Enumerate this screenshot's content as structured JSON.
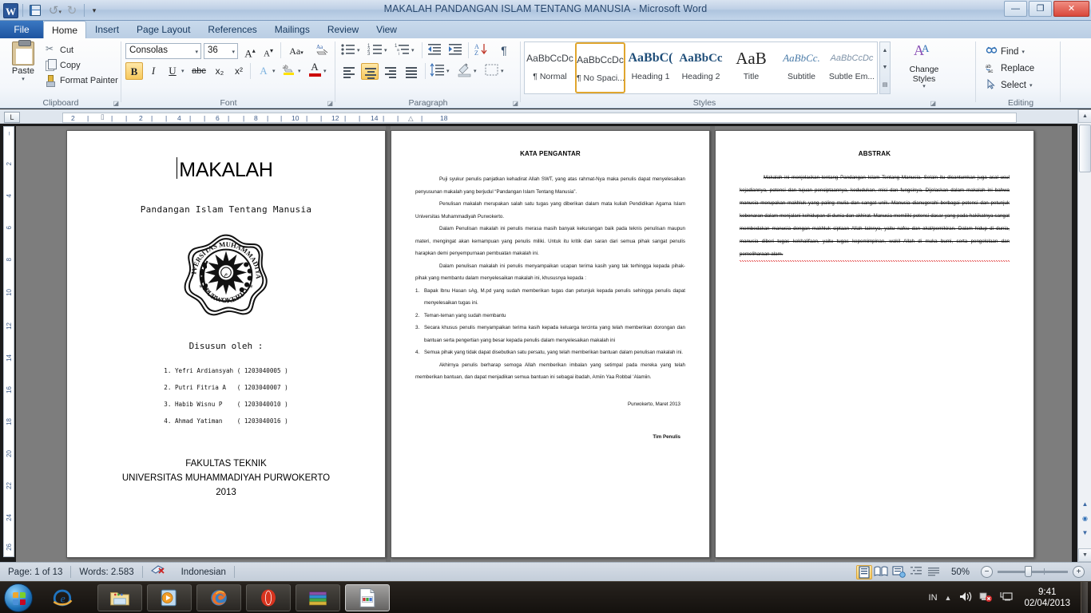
{
  "window": {
    "title": "MAKALAH PANDANGAN ISLAM TENTANG MANUSIA  -  Microsoft Word",
    "app_icon": "W",
    "minimize": "—",
    "maximize": "❐",
    "close": "✕"
  },
  "quick_access": {
    "save": "save-icon",
    "undo": "↺",
    "redo": "↻",
    "customize": "▾"
  },
  "tabs": [
    {
      "label": "File",
      "active": false,
      "file": true
    },
    {
      "label": "Home",
      "active": true
    },
    {
      "label": "Insert",
      "active": false
    },
    {
      "label": "Page Layout",
      "active": false
    },
    {
      "label": "References",
      "active": false
    },
    {
      "label": "Mailings",
      "active": false
    },
    {
      "label": "Review",
      "active": false
    },
    {
      "label": "View",
      "active": false
    }
  ],
  "ribbon": {
    "clipboard": {
      "group_label": "Clipboard",
      "paste_label": "Paste",
      "cut_label": "Cut",
      "copy_label": "Copy",
      "format_painter_label": "Format Painter"
    },
    "font": {
      "group_label": "Font",
      "font_name": "Consolas",
      "font_size": "36",
      "grow_font": "A",
      "shrink_font": "A",
      "change_case": "Aa",
      "clear_formatting": "clear-formatting-icon",
      "bold": "B",
      "italic": "I",
      "underline": "U",
      "strikethrough": "abc",
      "subscript": "x₂",
      "superscript": "x²",
      "text_effects": "A",
      "highlight": "ab",
      "font_color": "A"
    },
    "paragraph": {
      "group_label": "Paragraph",
      "bullets": "bullets-icon",
      "numbering": "numbering-icon",
      "multilevel": "multilevel-list-icon",
      "decrease_indent": "decrease-indent-icon",
      "increase_indent": "increase-indent-icon",
      "sort": "sort-icon",
      "show_marks": "¶",
      "align_left": "align-left-icon",
      "align_center": "align-center-icon",
      "align_right": "align-right-icon",
      "justify": "justify-icon",
      "line_spacing": "line-spacing-icon",
      "shading": "shading-icon",
      "borders": "borders-icon"
    },
    "styles": {
      "group_label": "Styles",
      "items": [
        {
          "sample": "AaBbCcDc",
          "name": "¶ Normal",
          "selected": false
        },
        {
          "sample": "AaBbCcDc",
          "name": "¶ No Spaci...",
          "selected": true
        },
        {
          "sample": "AaBbC(",
          "name": "Heading 1",
          "selected": false
        },
        {
          "sample": "AaBbCc",
          "name": "Heading 2",
          "selected": false
        },
        {
          "sample": "AaB",
          "name": "Title",
          "selected": false
        },
        {
          "sample": "AaBbCc.",
          "name": "Subtitle",
          "selected": false
        },
        {
          "sample": "AaBbCcDc",
          "name": "Subtle Em...",
          "selected": false
        }
      ],
      "change_styles_line1": "Change",
      "change_styles_line2": "Styles"
    },
    "editing": {
      "group_label": "Editing",
      "find": "Find",
      "replace": "Replace",
      "select": "Select"
    }
  },
  "ruler": {
    "horizontal_ticks": [
      "2",
      "2",
      "4",
      "6",
      "8",
      "10",
      "12",
      "14",
      "18"
    ],
    "vertical_ticks": [
      "2",
      "4",
      "6",
      "8",
      "10",
      "12",
      "14",
      "16",
      "18",
      "20",
      "22",
      "24",
      "26"
    ],
    "corner_tab_stop": "L"
  },
  "document": {
    "page1": {
      "title": "MAKALAH",
      "subtitle": "Pandangan Islam Tentang Manusia",
      "logo_alt": "universitas-muhammadiyah-purwokerto-logo",
      "authors_heading": "Disusun oleh :",
      "authors": [
        "1. Yefri Ardiansyah ( 1203040005 )",
        "2. Putri Fitria A   ( 1203040007 )",
        "3. Habib Wisnu P    ( 1203040010 )",
        "4. Ahmad Yatiman    ( 1203040016 )"
      ],
      "footer": [
        "FAKULTAS TEKNIK",
        "UNIVERSITAS MUHAMMADIYAH PURWOKERTO",
        "2013"
      ]
    },
    "page2": {
      "heading": "KATA PENGANTAR",
      "paragraphs": [
        "Puji syukur penulis panjatkan kehadirat Allah SWT, yang atas rahmat-Nya maka penulis dapat menyelesaikan penyusunan makalah yang berjudul “Pandangan Islam Tentang Manusia”.",
        "Penulisan makalah merupakan salah satu tugas yang diberikan dalam mata kuliah Pendidikan Agama Islam Universitas Muhammadiyah Purwokerto.",
        "Dalam Penulisan makalah ini penulis merasa masih banyak kekurangan baik pada teknis penulisan maupun materi, mengingat akan kemampuan yang penulis miliki. Untuk itu kritik dan saran dari semua pihak sangat penulis harapkan demi penyempurnaan pembuatan makalah ini.",
        "Dalam penulisan makalah ini penulis menyampaikan ucapan terima kasih yang tak terhingga kepada pihak-pihak yang membantu dalam menyelesaikan makalah ini, khususnya kepada :"
      ],
      "list": [
        "Bapak Ibnu Hasan sAg, M.pd yang sudah memberikan tugas dan petunjuk kepada penulis sehingga penulis dapat menyelesaikan tugas ini.",
        "Teman-teman yang sudah membantu",
        "Secara khusus penulis menyampaikan terima kasih kepada keluarga tercinta yang telah memberikan dorongan dan bantuan serta pengertian yang besar kepada penulis dalam menyelesaikan makalah ini",
        "Semua pihak yang tidak dapat disebutkan satu persatu, yang telah memberikan bantuan dalam penulisan makalah ini."
      ],
      "closing": "Akhirnya penulis berharap semoga Allah memberikan imbalan yang setimpal pada mereka yang telah memberikan bantuan, dan dapat menjadikan semua bantuan ini sebagai ibadah, Amiin Yaa Robbal ‘Alamiin.",
      "place_date": "Purwokerto, Maret 2013",
      "signature": "Tim Penulis"
    },
    "page3": {
      "heading": "ABSTRAK",
      "body": "Makalah ini menjelaskan tentang Pandangan Islam Tentang Manusia. Selain itu dicantumkan juga asal usul kejadiannya, potensi dan tujuan penciptaannya, kedudukan, misi dan fungsinya. Dijelaskan dalam makalah ini bahwa manusia merupakan makhluk yang paling mulia dan sangat unik. Manusia dianugerahi berbagai potensi dan petunjuk kebenaran dalam menjalani kehidupan di dunia dan akhirat. Manusia memiliki  potensi dasar yang pada hakikatnya sangat membedakan manusia dengan makhluk ciptaan Allah lainnya, yaitu nafsu dan akal/pemikiran. Dalam hidup di dunia, manusia diberi tugas kekhalifaan, yaitu tugas kepemimpinan, wakil Allah di muka bumi, serta pengelolaan dan pemeliharaan alam."
    }
  },
  "status_bar": {
    "page": "Page: 1 of 13",
    "words": "Words: 2.583",
    "proofing_icon": "proofing-errors-icon",
    "language": "Indonesian",
    "views": [
      {
        "name": "print-layout-view",
        "active": true
      },
      {
        "name": "full-screen-reading-view",
        "active": false
      },
      {
        "name": "web-layout-view",
        "active": false
      },
      {
        "name": "outline-view",
        "active": false
      },
      {
        "name": "draft-view",
        "active": false
      }
    ],
    "zoom": "50%",
    "zoom_out": "−",
    "zoom_in": "+"
  },
  "taskbar": {
    "start": "start-orb",
    "items": [
      {
        "name": "internet-explorer",
        "active": false
      },
      {
        "name": "windows-explorer",
        "active": false
      },
      {
        "name": "windows-media-player",
        "active": false
      },
      {
        "name": "mozilla-firefox",
        "active": false
      },
      {
        "name": "opera-browser",
        "active": false
      },
      {
        "name": "winrar",
        "active": false
      },
      {
        "name": "microsoft-word",
        "active": true
      }
    ],
    "tray_language": "IN",
    "tray_show_hidden": "▲",
    "tray_volume": "volume-icon",
    "tray_network": "network-error-icon",
    "tray_action_center": "action-center-icon",
    "clock_time": "9:41",
    "clock_date": "02/04/2013"
  }
}
